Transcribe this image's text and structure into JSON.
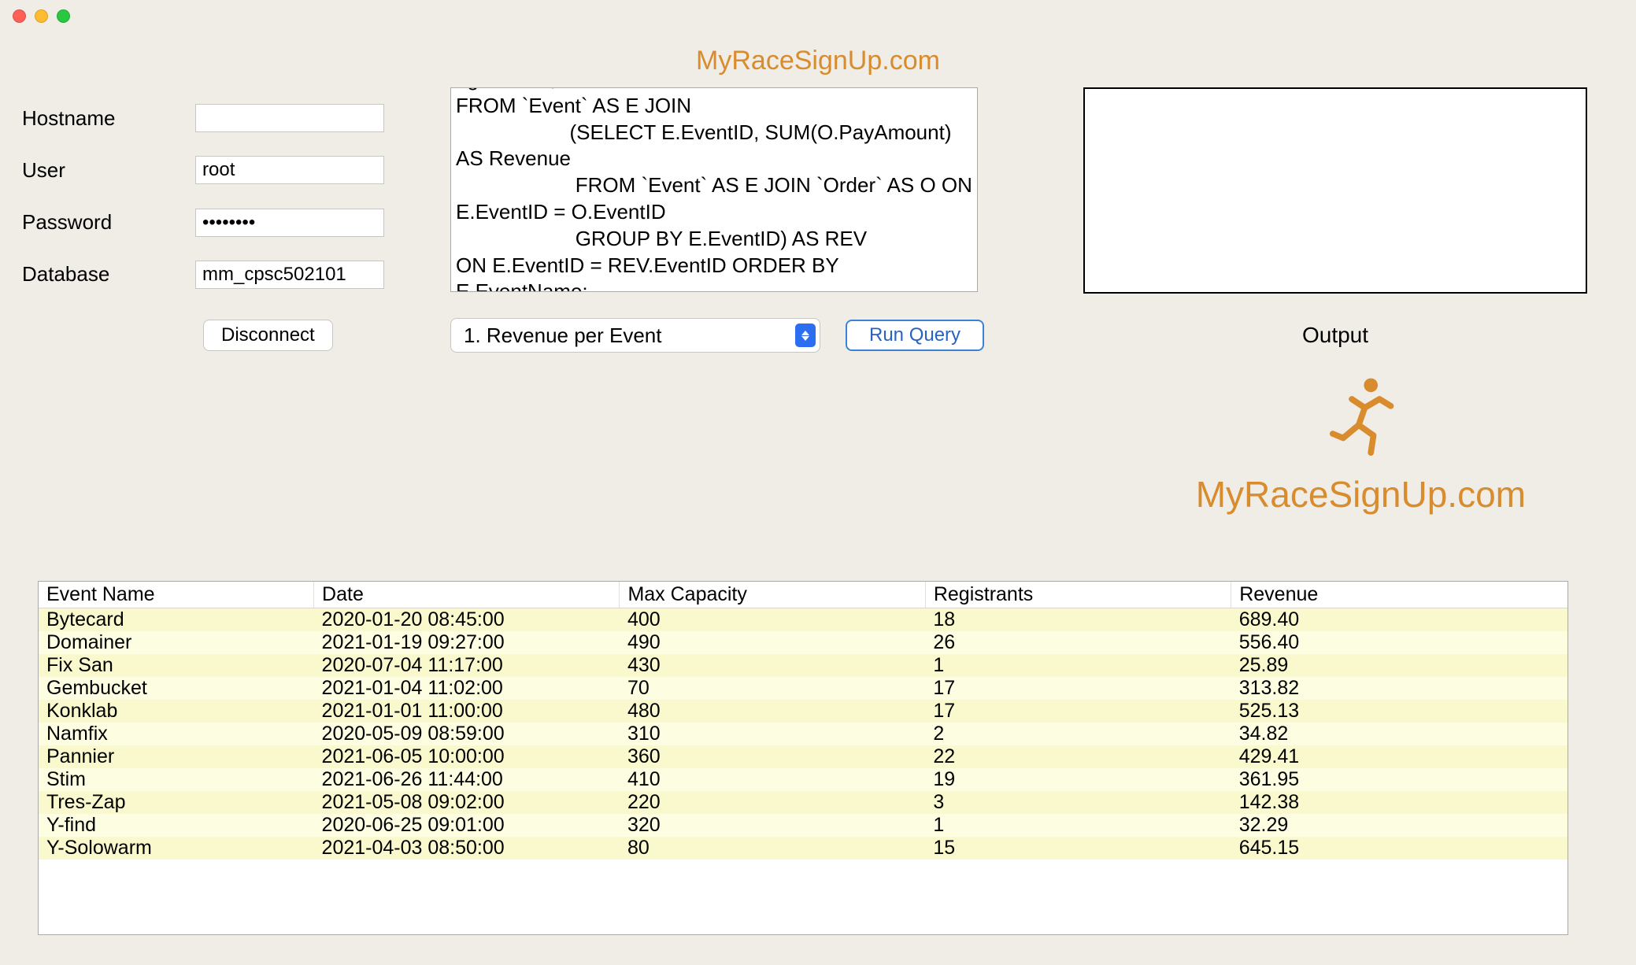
{
  "title": "MyRaceSignUp.com",
  "connection": {
    "labels": {
      "hostname": "Hostname",
      "user": "User",
      "password": "Password",
      "database": "Database"
    },
    "values": {
      "hostname": "",
      "user": "root",
      "password": "••••••••",
      "database": "mm_cpsc502101"
    },
    "disconnect_label": "Disconnect"
  },
  "query": {
    "text": "egistrants , REV.Revenue\nFROM `Event` AS E JOIN\n                    (SELECT E.EventID, SUM(O.PayAmount) AS Revenue\n                     FROM `Event` AS E JOIN `Order` AS O ON E.EventID = O.EventID\n                     GROUP BY E.EventID) AS REV\nON E.EventID = REV.EventID ORDER BY E.EventName;",
    "select_value": "1. Revenue per Event",
    "run_label": "Run Query"
  },
  "output": {
    "label": "Output",
    "text": ""
  },
  "logo_text": "MyRaceSignUp.com",
  "table": {
    "columns": [
      "Event Name",
      "Date",
      "Max Capacity",
      "Registrants",
      "Revenue"
    ],
    "widths": [
      "18%",
      "20%",
      "20%",
      "20%",
      "22%"
    ],
    "rows": [
      [
        "Bytecard",
        "2020-01-20 08:45:00",
        "400",
        "18",
        "689.40"
      ],
      [
        "Domainer",
        "2021-01-19 09:27:00",
        "490",
        "26",
        "556.40"
      ],
      [
        "Fix San",
        "2020-07-04 11:17:00",
        "430",
        "1",
        "25.89"
      ],
      [
        "Gembucket",
        "2021-01-04 11:02:00",
        "70",
        "17",
        "313.82"
      ],
      [
        "Konklab",
        "2021-01-01 11:00:00",
        "480",
        "17",
        "525.13"
      ],
      [
        "Namfix",
        "2020-05-09 08:59:00",
        "310",
        "2",
        "34.82"
      ],
      [
        "Pannier",
        "2021-06-05 10:00:00",
        "360",
        "22",
        "429.41"
      ],
      [
        "Stim",
        "2021-06-26 11:44:00",
        "410",
        "19",
        "361.95"
      ],
      [
        "Tres-Zap",
        "2021-05-08 09:02:00",
        "220",
        "3",
        "142.38"
      ],
      [
        "Y-find",
        "2020-06-25 09:01:00",
        "320",
        "1",
        "32.29"
      ],
      [
        "Y-Solowarm",
        "2021-04-03 08:50:00",
        "80",
        "15",
        "645.15"
      ]
    ]
  }
}
